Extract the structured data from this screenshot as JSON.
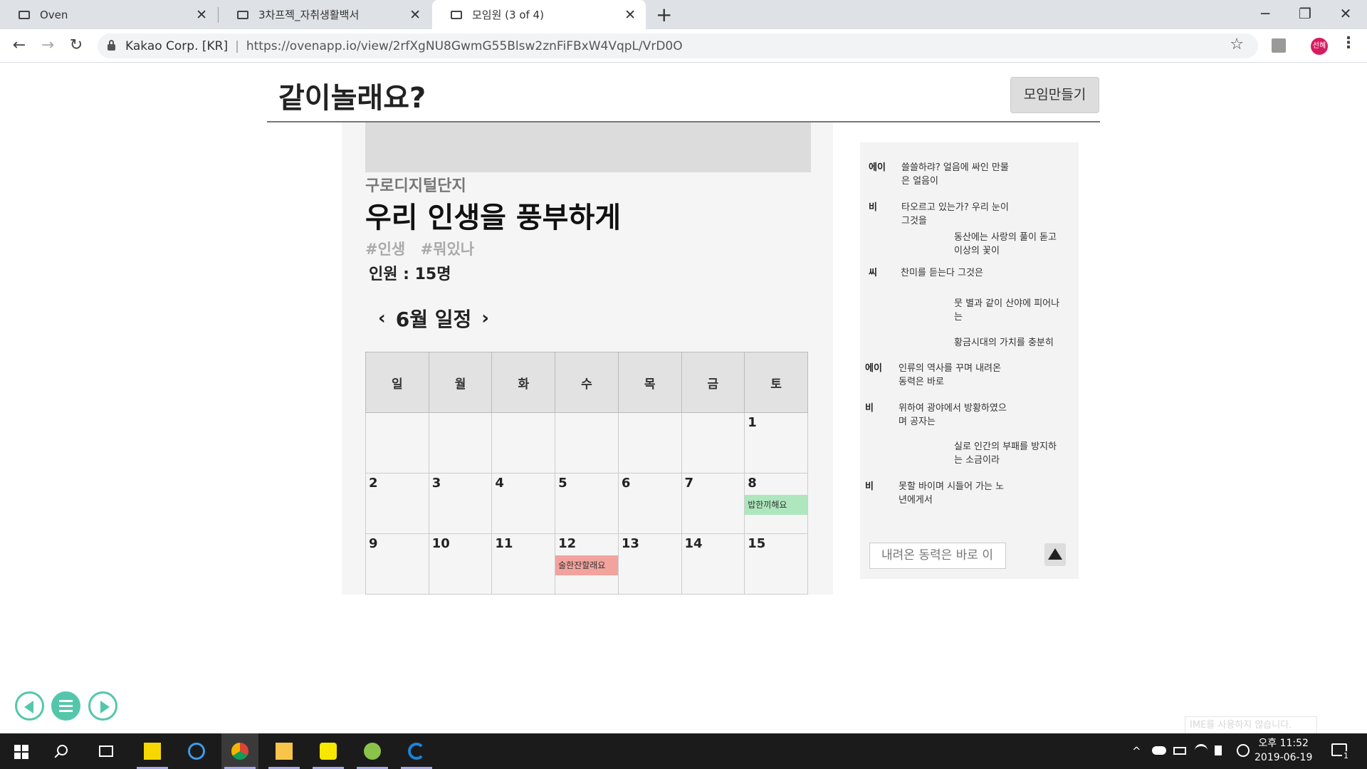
{
  "browser": {
    "tabs": [
      {
        "title": "Oven"
      },
      {
        "title": "3차프젝_자취생활백서"
      },
      {
        "title": "모임원 (3 of 4)"
      }
    ],
    "new_tab": "+",
    "window_controls": {
      "minimize": "─",
      "maximize": "❐",
      "close": "✕"
    },
    "nav": {
      "back": "←",
      "forward": "→",
      "reload": "↻"
    },
    "org": "Kakao Corp. [KR]",
    "url": "https://ovenapp.io/view/2rfXgNU8GwmG55Blsw2znFiFBxW4VqpL/VrD0O",
    "star": "☆",
    "profile_initials": "선혜",
    "menu": "⋮"
  },
  "page": {
    "site_title": "같이놀래요?",
    "create_button": "모임만들기",
    "location": "구로디지털단지",
    "group_title": "우리 인생을 풍부하게",
    "tags": [
      "#인생",
      "#뭐있나"
    ],
    "members": "인원 : 15명",
    "calendar": {
      "prev": "‹",
      "next": "›",
      "month_label": "6월 일정",
      "weekdays": [
        "일",
        "월",
        "화",
        "수",
        "목",
        "금",
        "토"
      ],
      "weeks": [
        [
          {
            "day": ""
          },
          {
            "day": ""
          },
          {
            "day": ""
          },
          {
            "day": ""
          },
          {
            "day": ""
          },
          {
            "day": ""
          },
          {
            "day": "1"
          }
        ],
        [
          {
            "day": "2"
          },
          {
            "day": "3"
          },
          {
            "day": "4"
          },
          {
            "day": "5"
          },
          {
            "day": "6"
          },
          {
            "day": "7"
          },
          {
            "day": "8",
            "event": "밥한끼해요",
            "event_color": "green"
          }
        ],
        [
          {
            "day": "9"
          },
          {
            "day": "10"
          },
          {
            "day": "11"
          },
          {
            "day": "12",
            "event": "술한잔할래요",
            "event_color": "red"
          },
          {
            "day": "13"
          },
          {
            "day": "14"
          },
          {
            "day": "15"
          }
        ]
      ]
    }
  },
  "chat": {
    "messages": [
      {
        "who": "에이",
        "text": "쓸쓸하랴? 얼음에 싸인 만물\n은 얼음이"
      },
      {
        "who": "비",
        "text": "타오르고 있는가? 우리 눈이\n그것을"
      },
      {
        "who": "",
        "text": "동산에는 사랑의 풀이 돋고\n이상의 꽃이"
      },
      {
        "who": "씨",
        "text": "찬미를 듣는다 그것은"
      },
      {
        "who": "",
        "text": "뭇 별과 같이 산야에 피어나\n는"
      },
      {
        "who": "",
        "text": "황금시대의 가치를 충분히"
      },
      {
        "who": "에이",
        "text": "인류의 역사를 꾸며 내려온\n동력은 바로"
      },
      {
        "who": "비",
        "text": "위하여 광야에서 방황하였으\n며 공자는"
      },
      {
        "who": "",
        "text": "실로 인간의 부패를 방지하\n는 소금이라"
      },
      {
        "who": "비",
        "text": "못할 바이며 시들어 가는 노\n년에게서"
      }
    ],
    "input_value": "내려온 동력은 바로 이"
  },
  "ime_notice": "IME를 사용하지 않습니다.",
  "taskbar": {
    "clock_time": "오후 11:52",
    "clock_date": "2019-06-19",
    "notification_count": "1",
    "tray_up": "^"
  }
}
